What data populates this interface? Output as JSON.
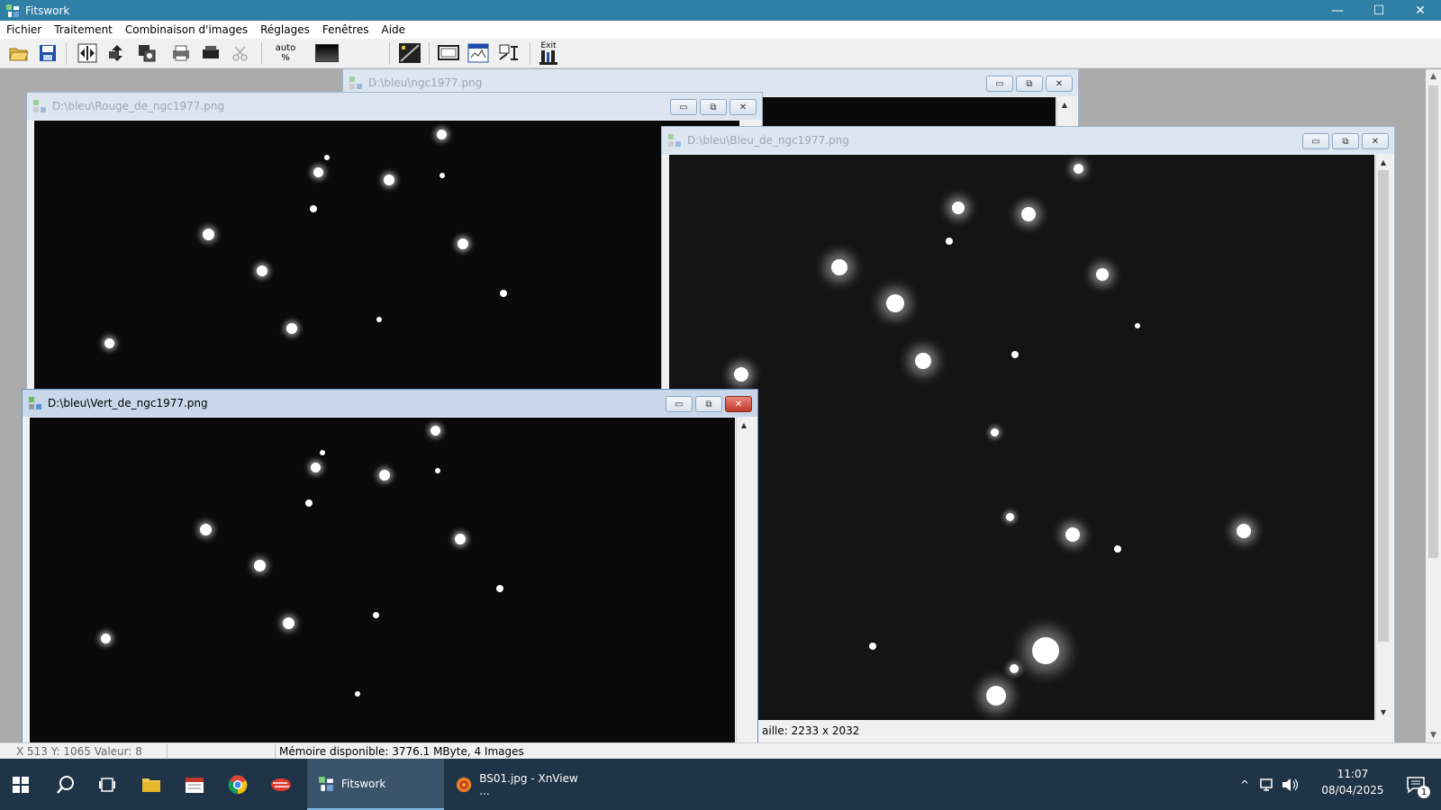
{
  "app": {
    "title": "Fitswork",
    "window_controls": {
      "minimize": "—",
      "maximize": "☐",
      "close": "✕"
    }
  },
  "menu": [
    "Fichier",
    "Traitement",
    "Combinaison d'images",
    "Réglages",
    "Fenêtres",
    "Aide"
  ],
  "toolbar": {
    "auto_label_1": "auto",
    "auto_label_2": "%",
    "exit_label": "Exit",
    "icons": [
      "open-icon",
      "save-icon",
      "flip-horizontal-icon",
      "flip-vertical-icon",
      "copy-channels-icon",
      "print-icon",
      "stack-icon",
      "scissors-icon",
      "auto-percent-icon",
      "gradient-icon",
      "histogram-icon",
      "display-icon",
      "window-icon",
      "measure-icon",
      "exit-icon"
    ]
  },
  "windows": {
    "ngc": {
      "title": "D:\\bleu\\ngc1977.png"
    },
    "rouge": {
      "title": "D:\\bleu\\Rouge_de_ngc1977.png"
    },
    "bleu": {
      "title": "D:\\bleu\\Bleu_de_ngc1977.png",
      "status": "aille: 2233 x 2032"
    },
    "vert": {
      "title": "D:\\bleu\\Vert_de_ngc1977.png"
    }
  },
  "statusbar": {
    "coords": "X 513  Y: 1065  Valeur: 8",
    "empty": "",
    "memory": "Mémoire disponible: 3776.1 MByte, 4 Images"
  },
  "taskbar": {
    "apps": [
      {
        "label": "Fitswork",
        "icon": "fitswork-icon",
        "active": true
      },
      {
        "label": "BS01.jpg - XnView ...",
        "icon": "xnview-icon",
        "active": false
      }
    ],
    "clock_time": "11:07",
    "clock_date": "08/04/2025",
    "notification_count": "1"
  }
}
